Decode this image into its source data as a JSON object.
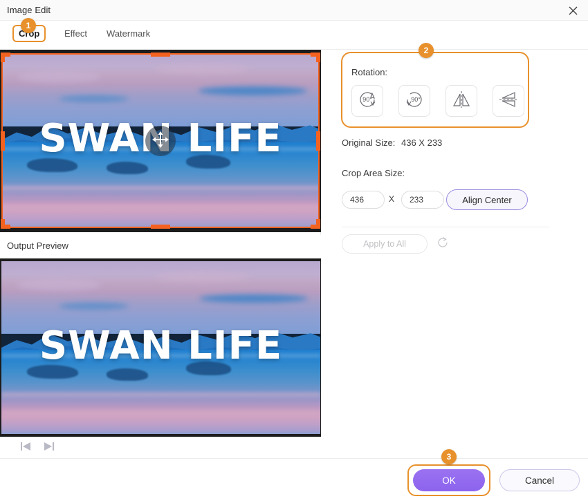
{
  "window": {
    "title": "Image Edit",
    "close_icon": "close-icon"
  },
  "tabs": [
    {
      "label": "Crop",
      "active": true
    },
    {
      "label": "Effect",
      "active": false
    },
    {
      "label": "Watermark",
      "active": false
    }
  ],
  "badges": {
    "one": "1",
    "two": "2",
    "three": "3"
  },
  "preview": {
    "image_title": "SWAN LIFE",
    "output_preview_label": "Output Preview",
    "move_handle_icon": "move-icon",
    "prev_icon": "skip-previous-icon",
    "next_icon": "skip-next-icon"
  },
  "panel": {
    "rotation_label": "Rotation:",
    "rotate_buttons": [
      {
        "name": "rotate-right-90",
        "label": "90°"
      },
      {
        "name": "rotate-left-90",
        "label": "90°"
      },
      {
        "name": "flip-horizontal",
        "label": ""
      },
      {
        "name": "flip-vertical",
        "label": ""
      }
    ],
    "original_size_label": "Original Size:",
    "original_size_value": "436 X 233",
    "crop_area_size_label": "Crop Area Size:",
    "crop_width": "436",
    "crop_separator": "X",
    "crop_height": "233",
    "align_center_label": "Align Center",
    "apply_to_all_label": "Apply to All",
    "reset_icon": "reset-rotate-icon"
  },
  "footer": {
    "ok_label": "OK",
    "cancel_label": "Cancel"
  },
  "colors": {
    "accent_orange": "#e8912c",
    "crop_frame": "#f4621f",
    "ok_purple": "#8c63ee",
    "align_border": "#9b8ce0",
    "disabled_text": "#c2c2c6"
  }
}
